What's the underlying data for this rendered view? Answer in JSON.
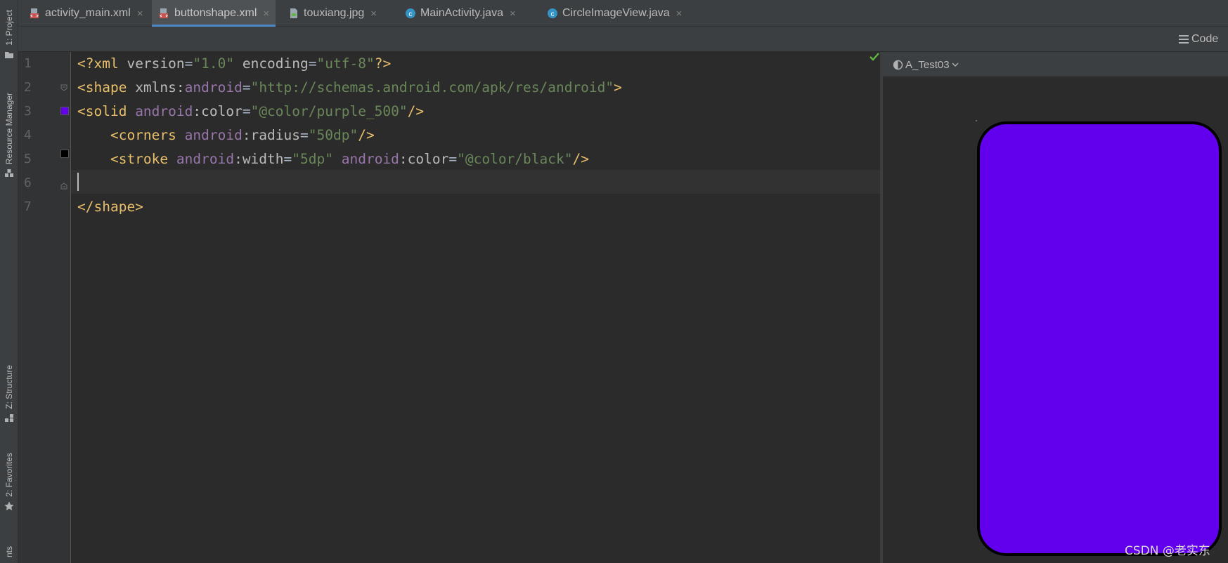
{
  "tool_windows": {
    "project": "1: Project",
    "resource_manager": "Resource Manager",
    "structure": "Z: Structure",
    "favorites": "2: Favorites",
    "build_variants": "nts"
  },
  "tabs": [
    {
      "label": "activity_main.xml",
      "icon": "xml-layout-icon",
      "active": false
    },
    {
      "label": "buttonshape.xml",
      "icon": "xml-layout-icon",
      "active": true
    },
    {
      "label": "touxiang.jpg",
      "icon": "image-file-icon",
      "active": false
    },
    {
      "label": "MainActivity.java",
      "icon": "java-class-icon",
      "active": false
    },
    {
      "label": "CircleImageView.java",
      "icon": "java-class-icon",
      "active": false
    }
  ],
  "close_glyph": "×",
  "view_mode": {
    "label": "Code",
    "icon": "lines-icon"
  },
  "editor": {
    "line_numbers": [
      "1",
      "2",
      "3",
      "4",
      "5",
      "6",
      "7"
    ],
    "lines": [
      [
        {
          "c": "pi",
          "t": "<?xml "
        },
        {
          "c": "at",
          "t": "version"
        },
        {
          "c": "tx",
          "t": "="
        },
        {
          "c": "st",
          "t": "\"1.0\""
        },
        {
          "c": "at",
          "t": " encoding"
        },
        {
          "c": "tx",
          "t": "="
        },
        {
          "c": "st",
          "t": "\"utf-8\""
        },
        {
          "c": "pi",
          "t": "?>"
        }
      ],
      [
        {
          "c": "tg",
          "t": "<shape "
        },
        {
          "c": "at",
          "t": "xmlns:"
        },
        {
          "c": "ns",
          "t": "android"
        },
        {
          "c": "tx",
          "t": "="
        },
        {
          "c": "st",
          "t": "\"http://schemas.android.com/apk/res/android\""
        },
        {
          "c": "tg",
          "t": ">"
        }
      ],
      [
        {
          "c": "tg",
          "t": "<solid "
        },
        {
          "c": "ns",
          "t": "android"
        },
        {
          "c": "at",
          "t": ":color"
        },
        {
          "c": "tx",
          "t": "="
        },
        {
          "c": "st",
          "t": "\"@color/purple_500\""
        },
        {
          "c": "tg",
          "t": "/>"
        }
      ],
      [
        {
          "c": "tg",
          "t": "    <corners "
        },
        {
          "c": "ns",
          "t": "android"
        },
        {
          "c": "at",
          "t": ":radius"
        },
        {
          "c": "tx",
          "t": "="
        },
        {
          "c": "st",
          "t": "\"50dp\""
        },
        {
          "c": "tg",
          "t": "/>"
        }
      ],
      [
        {
          "c": "tg",
          "t": "    <stroke "
        },
        {
          "c": "ns",
          "t": "android"
        },
        {
          "c": "at",
          "t": ":width"
        },
        {
          "c": "tx",
          "t": "="
        },
        {
          "c": "st",
          "t": "\"5dp\" "
        },
        {
          "c": "ns",
          "t": "android"
        },
        {
          "c": "at",
          "t": ":color"
        },
        {
          "c": "tx",
          "t": "="
        },
        {
          "c": "st",
          "t": "\"@color/black\""
        },
        {
          "c": "tg",
          "t": "/>"
        }
      ],
      [],
      [
        {
          "c": "tg",
          "t": "</shape>"
        }
      ]
    ],
    "gutter_swatches": [
      {
        "line": 3,
        "color": "#6200ee"
      },
      {
        "line": 5,
        "color": "#000000"
      }
    ],
    "caret_line": 6
  },
  "preview": {
    "theme_label": "A_Test03",
    "shape_fill": "#6200ee",
    "shape_stroke": "#000000"
  },
  "watermark": "CSDN @老实东"
}
